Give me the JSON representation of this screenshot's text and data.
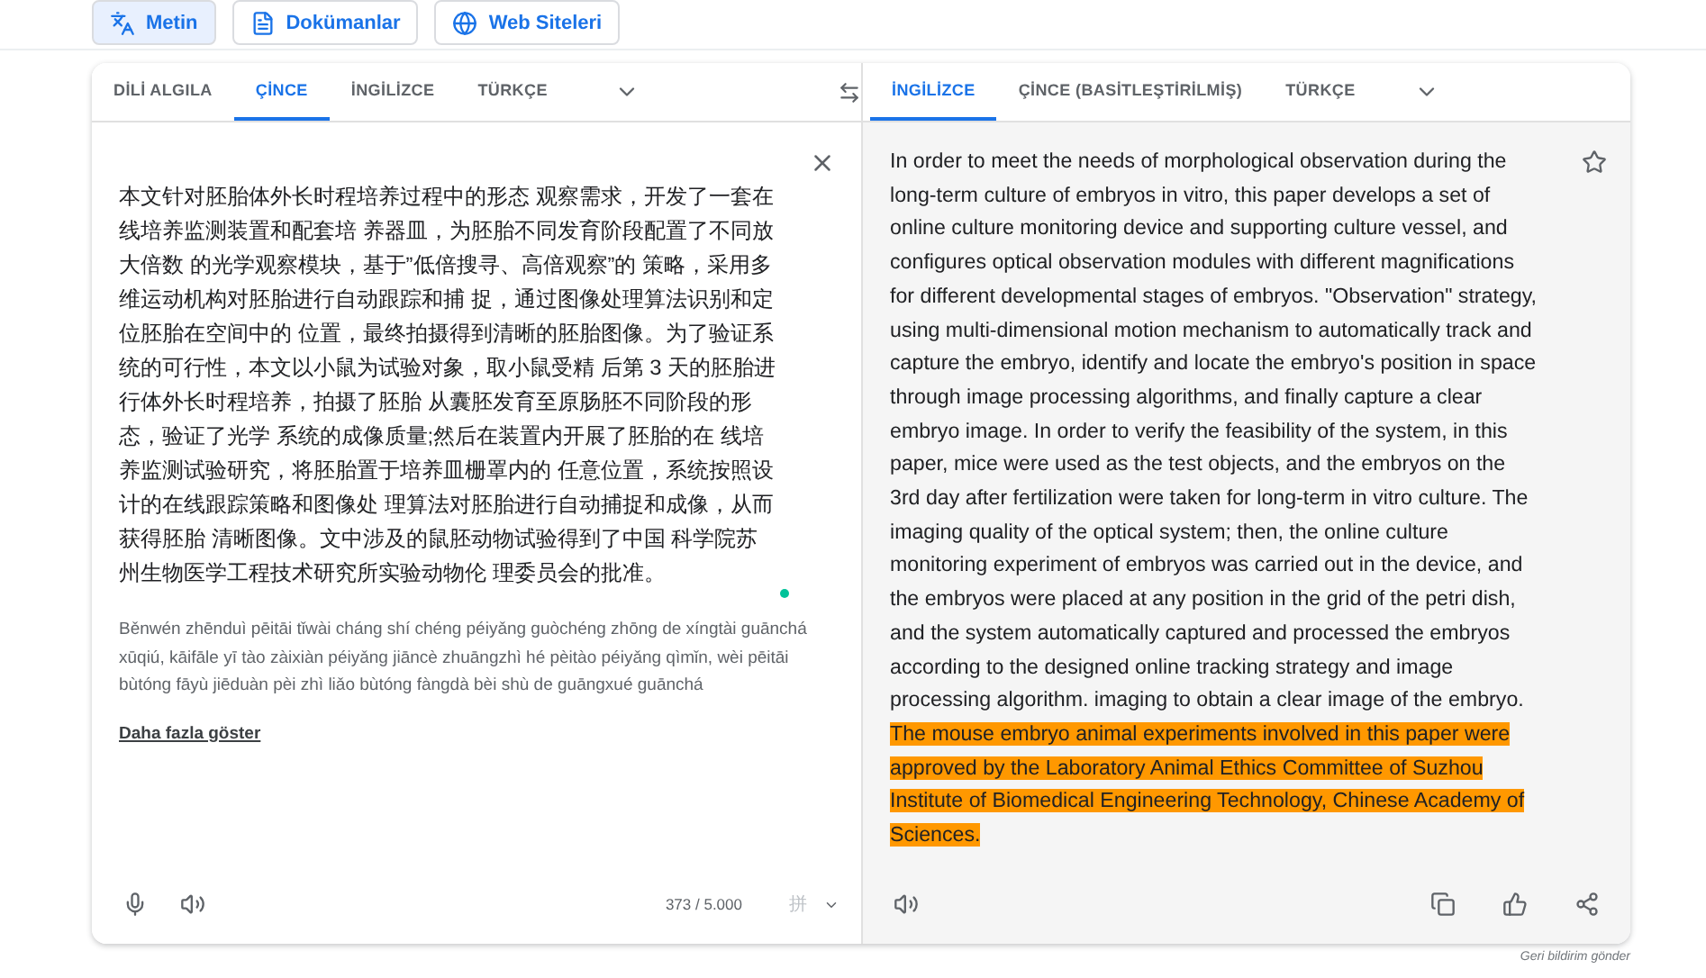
{
  "modes": [
    {
      "label": "Metin",
      "selected": true
    },
    {
      "label": "Dokümanlar",
      "selected": false
    },
    {
      "label": "Web Siteleri",
      "selected": false
    }
  ],
  "source_tabs": [
    {
      "label": "DİLİ ALGILA",
      "selected": false
    },
    {
      "label": "ÇİNCE",
      "selected": true
    },
    {
      "label": "İNGİLİZCE",
      "selected": false
    },
    {
      "label": "TÜRKÇE",
      "selected": false
    }
  ],
  "target_tabs": [
    {
      "label": "İNGİLİZCE",
      "selected": true
    },
    {
      "label": "ÇİNCE (BASİTLEŞTİRİLMİŞ)",
      "selected": false
    },
    {
      "label": "TÜRKÇE",
      "selected": false
    }
  ],
  "source": {
    "text": "本文针对胚胎体外长时程培养过程中的形态 观察需求，开发了一套在线培养监测装置和配套培 养器皿，为胚胎不同发育阶段配置了不同放大倍数 的光学观察模块，基于”低倍搜寻、高倍观察”的 策略，采用多维运动机构对胚胎进行自动跟踪和捕 捉，通过图像处理算法识别和定位胚胎在空间中的 位置，最终拍摄得到清晰的胚胎图像。为了验证系统的可行性，本文以小鼠为试验对象，取小鼠受精 后第 3 天的胚胎进行体外长时程培养，拍摄了胚胎 从囊胚发育至原肠胚不同阶段的形态，验证了光学 系统的成像质量;然后在装置内开展了胚胎的在 线培养监测试验研究，将胚胎置于培养皿栅罩内的 任意位置，系统按照设计的在线跟踪策略和图像处 理算法对胚胎进行自动捕捉和成像，从而获得胚胎 清晰图像。文中涉及的鼠胚动物试验得到了中国 科学院苏州生物医学工程技术研究所实验动物伦 理委员会的批准。",
    "romanization": "Běnwén zhēnduì pēitāi tǐwài cháng shí chéng péiyǎng guòchéng zhōng de xíngtài guānchá xūqiú, kāifāle yī tào zàixiàn péiyǎng jiāncè zhuāngzhì hé pèitào péiyǎng qìmǐn, wèi pēitāi bùtóng fāyù jiēduàn pèi zhì liǎo bùtóng fàngdà bèi shù de guāngxué guānchá",
    "show_more": "Daha fazla göster",
    "char_count": "373 / 5.000",
    "ime": "拼"
  },
  "translation": {
    "segments": [
      {
        "text": "In order to meet the needs of morphological observation during the long-term culture of embryos in vitro, this paper develops a set of online culture monitoring device and supporting culture vessel, and configures optical observation modules with different magnifications for different developmental stages of embryos. \"Observation\" strategy, using multi-dimensional motion mechanism to automatically track and capture the embryo, identify and locate the embryo's position in space through image processing algorithms, and finally capture a clear embryo image. In order to verify the feasibility of the system, in this paper, mice were used as the test objects, and the embryos on the 3rd day after fertilization were taken for long-term in vitro culture. The imaging quality of the optical system; then, the online culture monitoring experiment of embryos was carried out in the device, and the embryos were placed at any position in the grid of the petri dish, and the system automatically captured and processed the embryos according to the designed online tracking strategy and image processing algorithm. imaging to obtain a clear image of the embryo. ",
        "highlighted": false
      },
      {
        "text": "The mouse embryo animal experiments involved in this paper were approved by the Laboratory Animal Ethics Committee of Suzhou Institute of Biomedical Engineering Technology, Chinese Academy of Sciences.",
        "highlighted": true
      }
    ]
  },
  "feedback": "Geri bildirim gönder"
}
